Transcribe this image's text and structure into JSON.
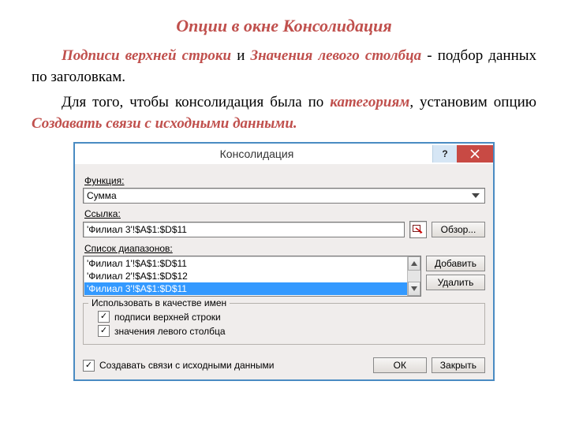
{
  "title": "Опции в окне Консолидация",
  "para1": {
    "s1": "Подписи верхней строки",
    "s2": " и ",
    "s3": "Значения левого столбца",
    "s4": " - подбор данных по заголовкам."
  },
  "para2": {
    "s1": "Для того, чтобы консолидация была по ",
    "s2": "категориям",
    "s3": ", установим опцию ",
    "s4": "Создавать связи с исходными данными."
  },
  "dialog": {
    "title": "Консолидация",
    "function_label": "Функция:",
    "function_value": "Сумма",
    "ref_label": "Ссылка:",
    "ref_value": "'Филиал 3'!$A$1:$D$11",
    "list_label": "Список диапазонов:",
    "list_items": [
      "'Филиал 1'!$A$1:$D$11",
      "'Филиал 2'!$A$1:$D$12",
      "'Филиал 3'!$A$1:$D$11"
    ],
    "list_selected": 2,
    "group_label": "Использовать в качестве имен",
    "check_top": "подписи верхней строки",
    "check_left": "значения левого столбца",
    "check_links": "Создавать связи с исходными данными",
    "btn_browse": "Обзор...",
    "btn_add": "Добавить",
    "btn_delete": "Удалить",
    "btn_ok": "ОК",
    "btn_close": "Закрыть"
  }
}
